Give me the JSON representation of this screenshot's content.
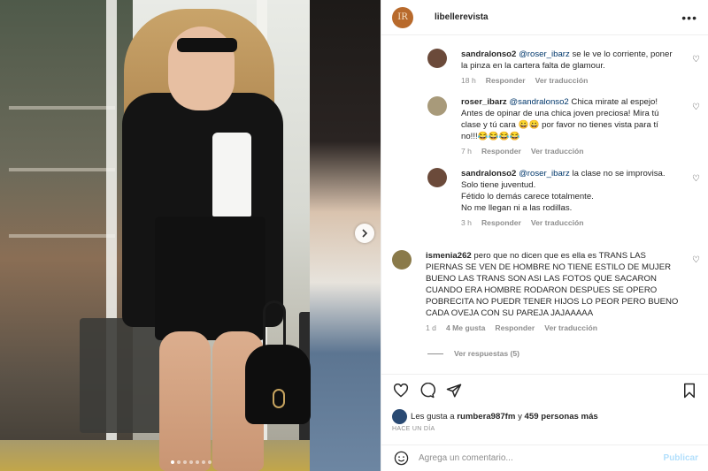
{
  "post": {
    "username": "libellerevista",
    "avatar_initials": "IR",
    "more_icon": "more-horizontal-icon",
    "photo": {
      "slide_count": 7,
      "active_slide": 1
    }
  },
  "comments": [
    {
      "user": "sandralonso2",
      "mention": "@roser_ibarz",
      "lines": [
        "se le ve lo corriente, poner",
        "la pinza en la cartera falta de glamour."
      ],
      "first_line": "se le ve lo corriente, poner",
      "rest": "la pinza en la cartera falta de glamour.",
      "time": "18 h",
      "reply": "Responder",
      "translate": "Ver traducción",
      "avatar_color": "#6b4a3a"
    },
    {
      "user": "roser_ibarz",
      "mention": "@sandralonso2",
      "first_line": "Chica mirate al espejo!",
      "line2": "Antes de opinar de una chica joven preciosa! Mira tú",
      "line3": "clase y tú cara 😀😀 por favor no tienes vista para tí",
      "line4": "no!!!😂😂😂😂",
      "time": "7 h",
      "reply": "Responder",
      "translate": "Ver traducción",
      "avatar_color": "#a89a7a"
    },
    {
      "user": "sandralonso2",
      "mention": "@roser_ibarz",
      "first_line": "la clase no se improvisa.",
      "line2": "Solo tiene juventud.",
      "line3": "Fétido lo demás carece totalmente.",
      "line4": "No me llegan ni a las rodillas.",
      "time": "3 h",
      "reply": "Responder",
      "translate": "Ver traducción",
      "avatar_color": "#6b4a3a"
    },
    {
      "user": "ismenia262",
      "first_line": "pero que no dicen que es ella es TRANS LAS",
      "line2": "PIERNAS SE VEN DE HOMBRE NO TIENE ESTILO DE MUJER",
      "line3": "BUENO LAS TRANS SON ASI LAS FOTOS QUE SACARON",
      "line4": "CUANDO ERA HOMBRE RODARON DESPUES SE OPERO",
      "line5": "POBRECITA NO PUEDR TENER HIJOS LO PEOR PERO BUENO",
      "line6": "CADA OVEJA CON SU PAREJA JAJAAAAA",
      "time": "1 d",
      "likes": "4 Me gusta",
      "reply": "Responder",
      "translate": "Ver traducción",
      "view_replies": "Ver respuestas (5)",
      "avatar_color": "#8a7a4a"
    }
  ],
  "actions": {
    "like_icon": "heart-icon",
    "comment_icon": "comment-icon",
    "share_icon": "send-icon",
    "save_icon": "bookmark-icon"
  },
  "likes": {
    "prefix": "Les gusta a",
    "user": "rumbera987fm",
    "conjunction": "y",
    "others": "459 personas más"
  },
  "time_ago": "HACE UN DÍA",
  "composer": {
    "placeholder": "Agrega un comentario...",
    "post_label": "Publicar",
    "emoji_icon": "emoji-icon"
  },
  "colors": {
    "brand_avatar": "#b86a2c",
    "mention": "#00376b",
    "muted": "#8e8e8e",
    "post_button": "#b2dffc"
  }
}
